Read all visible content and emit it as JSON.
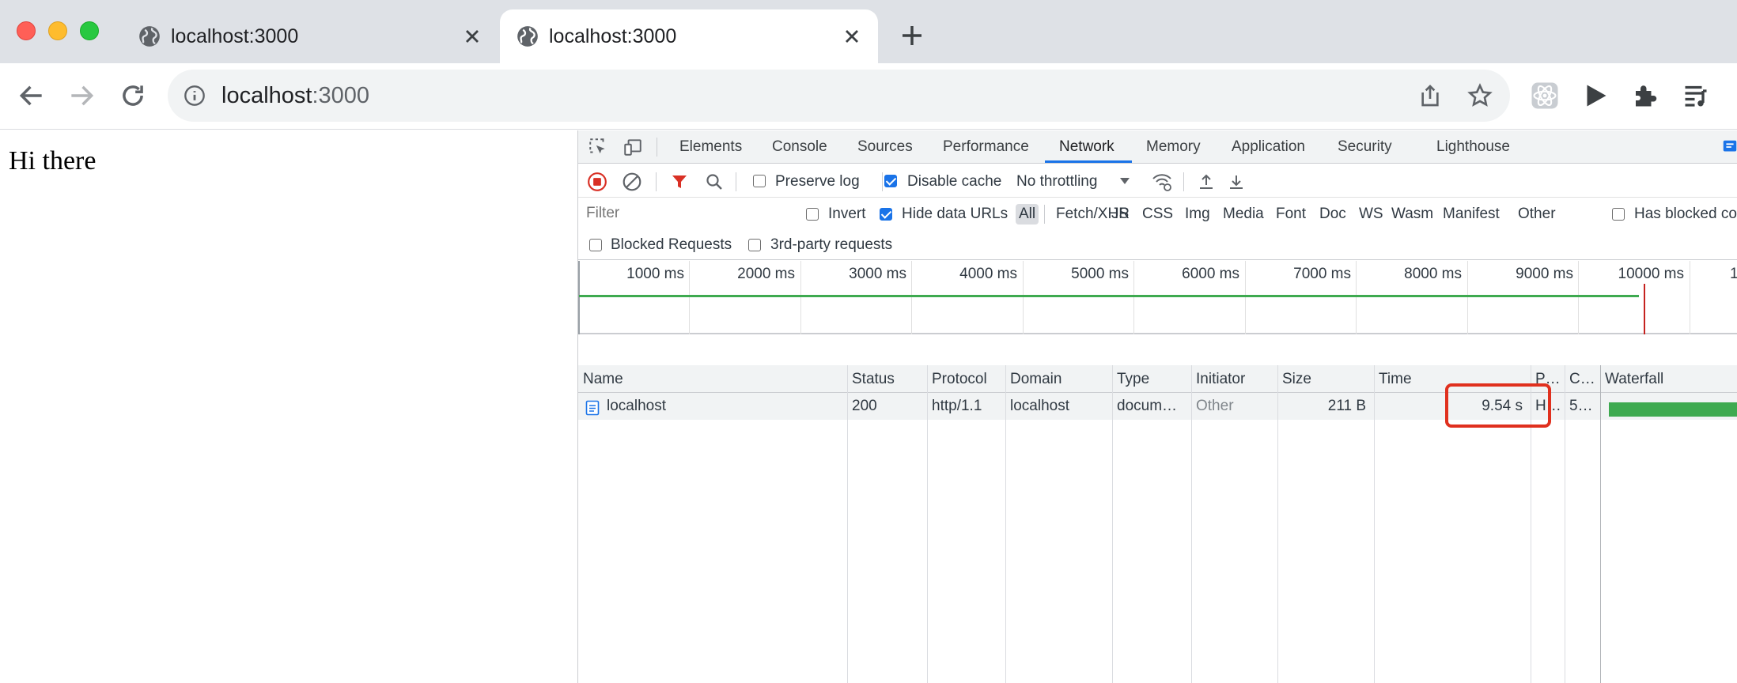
{
  "browser": {
    "tabs": [
      {
        "title": "localhost:3000",
        "active": false
      },
      {
        "title": "localhost:3000",
        "active": true
      }
    ],
    "address": {
      "host": "localhost",
      "port": ":3000"
    }
  },
  "page": {
    "text": "Hi there"
  },
  "devtools": {
    "panels": [
      "Elements",
      "Console",
      "Sources",
      "Performance",
      "Network",
      "Memory",
      "Application",
      "Security",
      "Lighthouse"
    ],
    "active_panel": "Network",
    "toolbar": {
      "preserve_log": {
        "label": "Preserve log",
        "checked": false
      },
      "disable_cache": {
        "label": "Disable cache",
        "checked": true
      },
      "throttling": "No throttling"
    },
    "filter": {
      "placeholder": "Filter",
      "invert": {
        "label": "Invert",
        "checked": false
      },
      "hide_data_urls": {
        "label": "Hide data URLs",
        "checked": true
      },
      "types": [
        "All",
        "Fetch/XHR",
        "JS",
        "CSS",
        "Img",
        "Media",
        "Font",
        "Doc",
        "WS",
        "Wasm",
        "Manifest",
        "Other"
      ],
      "active_type": "All",
      "has_blocked_cookies": {
        "label": "Has blocked co",
        "checked": false
      },
      "blocked_requests": {
        "label": "Blocked Requests",
        "checked": false
      },
      "third_party": {
        "label": "3rd-party requests",
        "checked": false
      }
    },
    "overview_ticks": [
      "1000 ms",
      "2000 ms",
      "3000 ms",
      "4000 ms",
      "5000 ms",
      "6000 ms",
      "7000 ms",
      "8000 ms",
      "9000 ms",
      "10000 ms",
      "1"
    ],
    "table": {
      "columns": [
        "Name",
        "Status",
        "Protocol",
        "Domain",
        "Type",
        "Initiator",
        "Size",
        "Time",
        "P…",
        "C…",
        "Waterfall"
      ],
      "rows": [
        {
          "name": "localhost",
          "status": "200",
          "protocol": "http/1.1",
          "domain": "localhost",
          "type": "docum…",
          "initiator": "Other",
          "size": "211 B",
          "time": "9.54 s",
          "priority": "H…",
          "connection": "5…"
        }
      ]
    }
  },
  "colors": {
    "accent": "#1a73e8",
    "waterfall_green": "#3eaa50",
    "highlight_red": "#e0301e",
    "record_red": "#d93025"
  }
}
